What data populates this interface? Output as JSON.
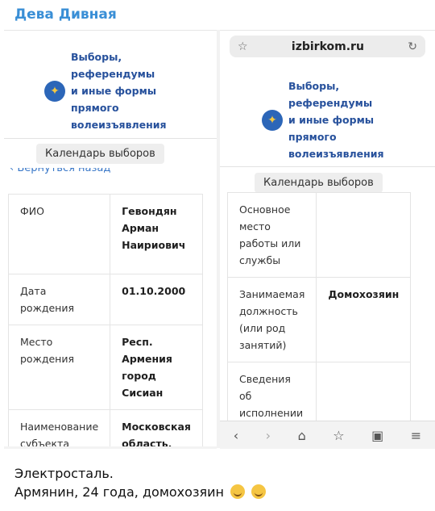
{
  "chat": {
    "sender": "Дева Дивная",
    "caption_line1": "Электросталь.",
    "caption_line2": "Армянин, 24 года, домохозяин"
  },
  "left_screenshot": {
    "brand_lines": [
      "Выборы,",
      "референдумы",
      "и иные формы",
      "прямого",
      "волеизъявления"
    ],
    "calendar_button": "Календарь выборов",
    "back_link": "Вернуться назад",
    "rows": [
      {
        "label": "ФИО",
        "value": "Гевондян Арман Наириович"
      },
      {
        "label": "Дата рождения",
        "value": "01.10.2000"
      },
      {
        "label": "Место рождения",
        "value": "Респ. Армения город Сисиан"
      },
      {
        "label": "Наименование субъекта Российской",
        "value": "Московская область, Городской"
      }
    ]
  },
  "right_screenshot": {
    "url": "izbirkom.ru",
    "brand_lines": [
      "Выборы,",
      "референдумы",
      "и иные формы",
      "прямого",
      "волеизъявления"
    ],
    "calendar_button": "Календарь выборов",
    "rows": [
      {
        "label": "Основное место работы или службы",
        "value": ""
      },
      {
        "label": "Занимаемая должность (или род занятий)",
        "value": "Домохозяин"
      },
      {
        "label": "Сведения об исполнении",
        "value": ""
      }
    ]
  },
  "icons": {
    "bookmark": "star-icon",
    "reload": "reload-icon",
    "nav": [
      "back-icon",
      "forward-icon",
      "home-icon",
      "bookmark-icon",
      "tabs-icon",
      "menu-icon"
    ]
  }
}
